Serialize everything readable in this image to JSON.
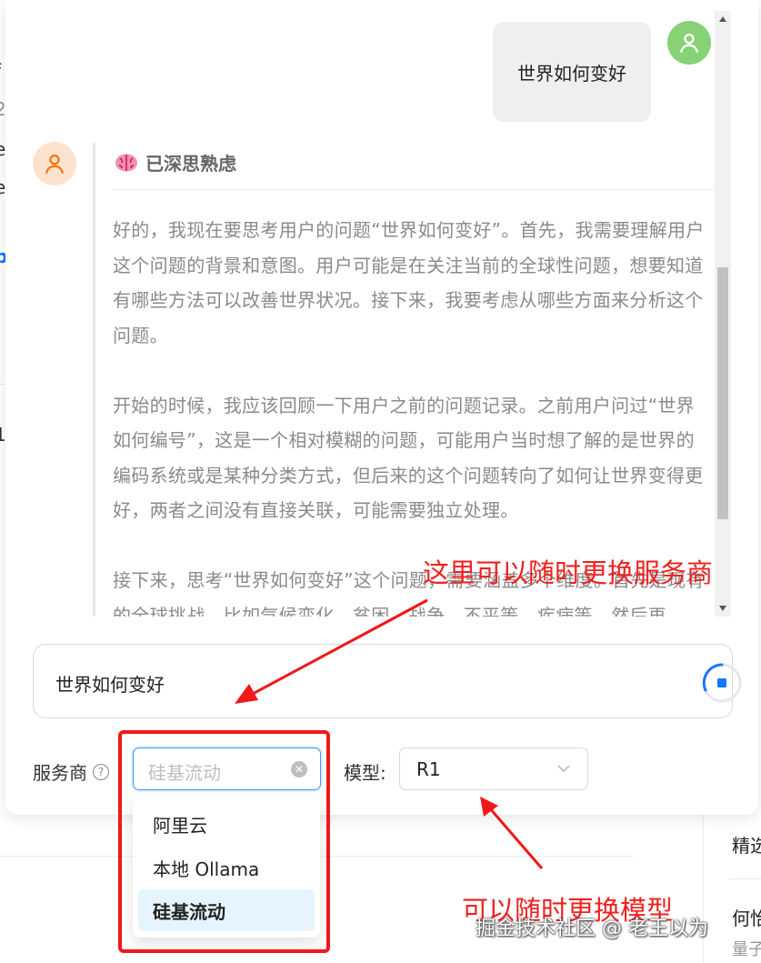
{
  "conversation": {
    "user_message": "世界如何变好",
    "thinking_label": "已深思熟虑",
    "thinking_paragraphs": [
      "好的，我现在要思考用户的问题“世界如何变好”。首先，我需要理解用户这个问题的背景和意图。用户可能是在关注当前的全球性问题，想要知道有哪些方法可以改善世界状况。接下来，我要考虑从哪些方面来分析这个问题。",
      "开始的时候，我应该回顾一下用户之前的问题记录。之前用户问过“世界如何编号”，这是一个相对模糊的问题，可能用户当时想了解的是世界的编码系统或是某种分类方式，但后来的这个问题转向了如何让世界变得更好，两者之间没有直接关联，可能需要独立处理。",
      "接下来，思考“世界如何变好”这个问题，需要涵盖多个维度。首先是现有的全球挑战，比如气候变化、贫困、战争、不平等、疾病等，然后再"
    ]
  },
  "input": {
    "value": "世界如何变好"
  },
  "controls": {
    "provider_label": "服务商",
    "provider_placeholder": "硅基流动",
    "model_label": "模型:",
    "model_value": "R1"
  },
  "dropdown": {
    "options": [
      "阿里云",
      "本地 Ollama",
      "硅基流动"
    ],
    "selected": "硅基流动"
  },
  "annotations": {
    "provider_note": "这里可以随时更换服务商",
    "model_note": "可以随时更换模型"
  },
  "background": {
    "left_fragments": [
      "f",
      "2",
      "e",
      "e",
      "p",
      "1"
    ],
    "right_fragments": [
      "精选",
      "何怡",
      "量子"
    ]
  },
  "watermark": "掘金技术社区 @ 老王以为",
  "colors": {
    "accent": "#1677ff",
    "annotation_red": "#f01818",
    "user_avatar": "#86d275",
    "bot_avatar": "#fde3cf"
  },
  "icons": {
    "user_avatar": "user-icon",
    "bot_avatar": "user-icon",
    "thinking": "brain-emoji",
    "stop": "stop-icon",
    "help": "question-circle-icon",
    "clear": "close-circle-icon",
    "model_dropdown": "chevron-down-icon"
  }
}
